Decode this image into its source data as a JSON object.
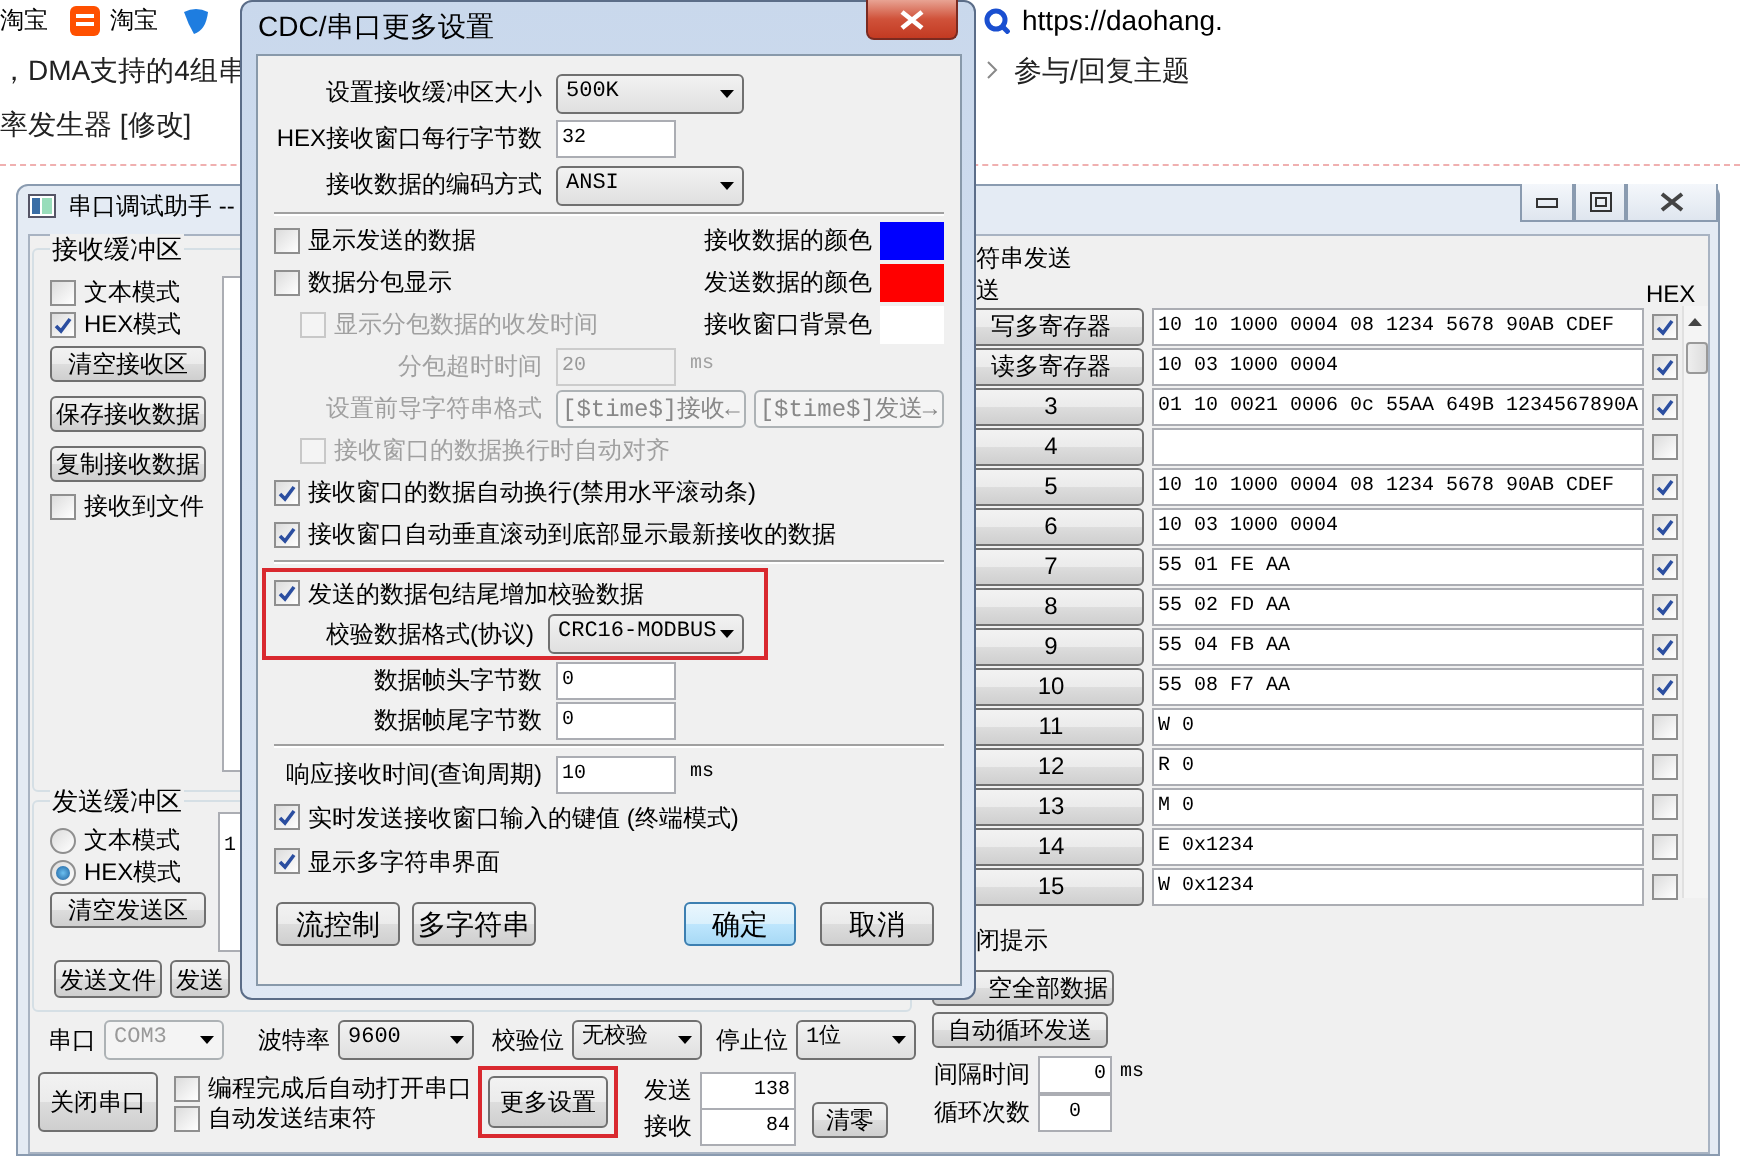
{
  "browser": {
    "bookmarks": [
      {
        "label": "淘宝",
        "kind": "text"
      },
      {
        "label": "淘宝",
        "kind": "taobao"
      },
      {
        "kind": "blue"
      }
    ],
    "address": "https://daohang.",
    "lines": [
      "，DMA支持的4组串",
      "率发生器 [修改]"
    ],
    "reply_link": "参与/回复主题"
  },
  "main_window": {
    "title": "串口调试助手 --",
    "receive_buffer": {
      "title": "接收缓冲区",
      "modes": [
        {
          "label": "文本模式",
          "checked": false
        },
        {
          "label": "HEX模式",
          "checked": true
        }
      ],
      "buttons": [
        "清空接收区",
        "保存接收数据",
        "复制接收数据"
      ],
      "to_file": {
        "label": "接收到文件",
        "checked": false
      }
    },
    "send_buffer": {
      "title": "发送缓冲区",
      "modes": [
        {
          "label": "文本模式",
          "selected": false
        },
        {
          "label": "HEX模式",
          "selected": true
        }
      ],
      "clear_button": "清空发送区",
      "content": "1",
      "buttons": [
        "发送文件",
        "发送"
      ]
    },
    "port_settings": [
      {
        "label": "串口",
        "value": "COM3",
        "disabled": true
      },
      {
        "label": "波特率",
        "value": "9600",
        "disabled": false
      },
      {
        "label": "校验位",
        "value": "无校验",
        "disabled": false
      },
      {
        "label": "停止位",
        "value": "1位",
        "disabled": false
      }
    ],
    "close_port_button": "关闭串口",
    "options": [
      {
        "label": "编程完成后自动打开串口",
        "checked": false
      },
      {
        "label": "自动发送结束符",
        "checked": false
      }
    ],
    "more_settings_button": {
      "label": "更多设置",
      "highlighted": true
    },
    "counters": [
      {
        "label": "发送",
        "value": "138"
      },
      {
        "label": "接收",
        "value": "84"
      }
    ],
    "reset_button": "清零",
    "multi_string": {
      "title": "符串发送",
      "subtitle": "送",
      "hex_header": "HEX",
      "rows": [
        {
          "button": "写多寄存器",
          "text": "10 10 1000 0004 08 1234 5678 90AB CDEF",
          "hex": true
        },
        {
          "button": "读多寄存器",
          "text": "10 03 1000 0004",
          "hex": true
        },
        {
          "button": "3",
          "text": "01 10 0021 0006 0c 55AA 649B 1234567890A",
          "hex": true
        },
        {
          "button": "4",
          "hex": false
        },
        {
          "button": "5",
          "text": "10 10 1000 0004 08 1234 5678 90AB CDEF",
          "hex": true
        },
        {
          "button": "6",
          "text": "10 03 1000 0004",
          "hex": true
        },
        {
          "button": "7",
          "text": "55 01 FE AA",
          "hex": true
        },
        {
          "button": "8",
          "text": "55 02 FD AA",
          "hex": true
        },
        {
          "button": "9",
          "text": "55 04 FB AA",
          "hex": true
        },
        {
          "button": "10",
          "text": "55 08 F7 AA",
          "hex": true
        },
        {
          "button": "11",
          "text": "W 0",
          "hex": false
        },
        {
          "button": "12",
          "text": "R 0",
          "hex": false
        },
        {
          "button": "13",
          "text": "M 0",
          "hex": false
        },
        {
          "button": "14",
          "text": "E 0x1234",
          "hex": false
        },
        {
          "button": "15",
          "text": "W 0x1234",
          "hex": false
        }
      ],
      "close_hint": "闭提示",
      "clear_all_button": "空全部数据",
      "loop_button": "自动循环发送",
      "interval": {
        "label": "间隔时间",
        "value": "0",
        "unit": "ms"
      },
      "loop_count": {
        "label": "循环次数",
        "value": "0"
      }
    }
  },
  "dialog": {
    "title": "CDC/串口更多设置",
    "sections": [
      {
        "rows": [
          {
            "kind": "select",
            "label": "设置接收缓冲区大小",
            "value": "500K",
            "disabled": false
          },
          {
            "kind": "field",
            "label": "HEX接收窗口每行字节数",
            "value": "32",
            "disabled": false
          },
          {
            "kind": "select",
            "label": "接收数据的编码方式",
            "value": "ANSI",
            "disabled": false
          }
        ]
      },
      {
        "rows": [
          {
            "kind": "check",
            "label": "显示发送的数据",
            "checked": false,
            "disabled": false,
            "swatch": {
              "label": "接收数据的颜色",
              "color": "#0000ff"
            }
          },
          {
            "kind": "check",
            "label": "数据分包显示",
            "checked": false,
            "disabled": false,
            "swatch": {
              "label": "发送数据的颜色",
              "color": "#ff0000"
            }
          },
          {
            "kind": "check",
            "label": "显示分包数据的收发时间",
            "checked": false,
            "disabled": true,
            "swatch": {
              "label": "接收窗口背景色",
              "color": "#ffffff"
            }
          },
          {
            "kind": "field",
            "label": "分包超时时间",
            "value": "20",
            "unit": "ms",
            "disabled": true
          },
          {
            "kind": "buttons",
            "label": "设置前导字符串格式",
            "buttons": [
              "[$time$]接收←",
              "[$time$]发送→"
            ],
            "disabled": true
          },
          {
            "kind": "check",
            "label": "接收窗口的数据换行时自动对齐",
            "checked": false,
            "disabled": true
          },
          {
            "kind": "check",
            "label": "接收窗口的数据自动换行(禁用水平滚动条)",
            "checked": true,
            "disabled": false
          },
          {
            "kind": "check",
            "label": "接收窗口自动垂直滚动到底部显示最新接收的数据",
            "checked": true,
            "disabled": false
          }
        ]
      },
      {
        "rows": [
          {
            "kind": "box",
            "highlighted": true,
            "disabled": false,
            "rows": [
              {
                "kind": "check",
                "label": "发送的数据包结尾增加校验数据",
                "checked": true,
                "disabled": false
              },
              {
                "kind": "select",
                "label": "校验数据格式(协议)",
                "value": "CRC16-MODBUS",
                "disabled": false
              }
            ]
          },
          {
            "kind": "field",
            "label": "数据帧头字节数",
            "value": "0",
            "disabled": false
          },
          {
            "kind": "field",
            "label": "数据帧尾字节数",
            "value": "0",
            "disabled": false
          }
        ]
      },
      {
        "rows": [
          {
            "kind": "field",
            "label": "响应接收时间(查询周期)",
            "value": "10",
            "unit": "ms",
            "disabled": false
          },
          {
            "kind": "check",
            "label": "实时发送接收窗口输入的键值 (终端模式)",
            "checked": true,
            "disabled": false
          },
          {
            "kind": "check",
            "label": "显示多字符串界面",
            "checked": true,
            "disabled": false
          }
        ]
      }
    ],
    "buttons": [
      {
        "label": "流控制",
        "default": false
      },
      {
        "label": "多字符串",
        "default": false
      },
      {
        "label": "确定",
        "default": true
      },
      {
        "label": "取消",
        "default": false
      }
    ]
  }
}
